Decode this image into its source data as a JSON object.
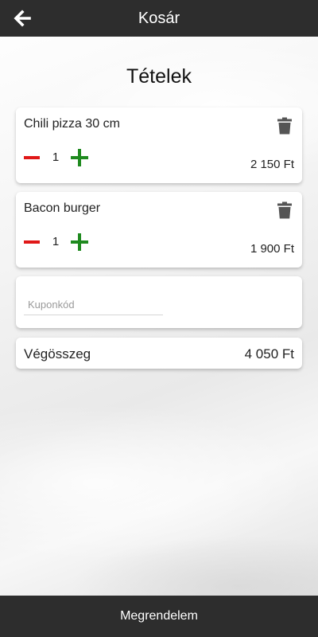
{
  "colors": {
    "bar": "#2d2d2d",
    "minus": "#e01818",
    "plus": "#1f8a1f",
    "trash": "#555555"
  },
  "header": {
    "title": "Kosár",
    "back_icon": "arrow-left-icon"
  },
  "section": {
    "title": "Tételek"
  },
  "items": [
    {
      "name": "Chili pizza 30 cm",
      "quantity": "1",
      "price": "2 150 Ft"
    },
    {
      "name": "Bacon burger",
      "quantity": "1",
      "price": "1 900 Ft"
    }
  ],
  "coupon": {
    "placeholder": "Kuponkód",
    "value": ""
  },
  "total": {
    "label": "Végösszeg",
    "value": "4 050 Ft"
  },
  "footer": {
    "order_label": "Megrendelem"
  }
}
